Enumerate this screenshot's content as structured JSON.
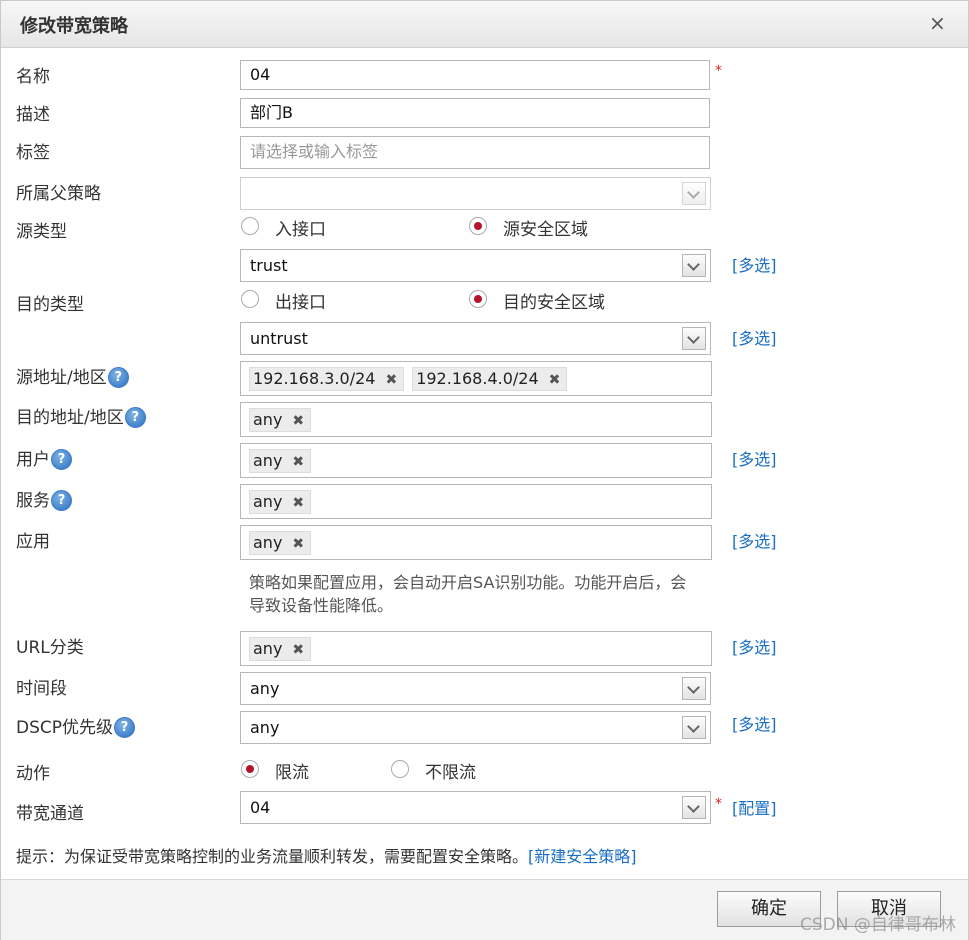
{
  "dialog": {
    "title": "修改带宽策略",
    "close_glyph": "×"
  },
  "fields": {
    "name": {
      "label": "名称",
      "value": "04",
      "required_mark": "*"
    },
    "desc": {
      "label": "描述",
      "value": "部门B"
    },
    "tags": {
      "label": "标签",
      "placeholder": "请选择或输入标签"
    },
    "parent": {
      "label": "所属父策略",
      "value": ""
    },
    "src_type": {
      "label": "源类型",
      "options": [
        "入接口",
        "源安全区域"
      ],
      "selected": "源安全区域"
    },
    "src_zone": {
      "value": "trust",
      "link": "[多选]"
    },
    "dst_type": {
      "label": "目的类型",
      "options": [
        "出接口",
        "目的安全区域"
      ],
      "selected": "目的安全区域"
    },
    "dst_zone": {
      "value": "untrust",
      "link": "[多选]"
    },
    "src_addr": {
      "label": "源地址/地区",
      "help": "?",
      "tags": [
        "192.168.3.0/24",
        "192.168.4.0/24"
      ]
    },
    "dst_addr": {
      "label": "目的地址/地区",
      "help": "?",
      "tags": [
        "any"
      ]
    },
    "user": {
      "label": "用户",
      "help": "?",
      "tags": [
        "any"
      ],
      "link": "[多选]"
    },
    "service": {
      "label": "服务",
      "help": "?",
      "tags": [
        "any"
      ]
    },
    "app": {
      "label": "应用",
      "tags": [
        "any"
      ],
      "link": "[多选]",
      "note": "策略如果配置应用，会自动开启SA识别功能。功能开启后，会导致设备性能降低。"
    },
    "url": {
      "label": "URL分类",
      "tags": [
        "any"
      ],
      "link": "[多选]"
    },
    "time": {
      "label": "时间段",
      "value": "any"
    },
    "dscp": {
      "label": "DSCP优先级",
      "help": "?",
      "value": "any",
      "link": "[多选]"
    },
    "action": {
      "label": "动作",
      "options": [
        "限流",
        "不限流"
      ],
      "selected": "限流"
    },
    "channel": {
      "label": "带宽通道",
      "value": "04",
      "required_mark": "*",
      "link": "[配置]"
    }
  },
  "tip": {
    "text": "提示：为保证受带宽策略控制的业务流量顺利转发，需要配置安全策略。",
    "link": "[新建安全策略]"
  },
  "buttons": {
    "ok": "确定",
    "cancel": "取消"
  },
  "tag_remove_glyph": "✖",
  "watermark": "CSDN @自律哥布林"
}
